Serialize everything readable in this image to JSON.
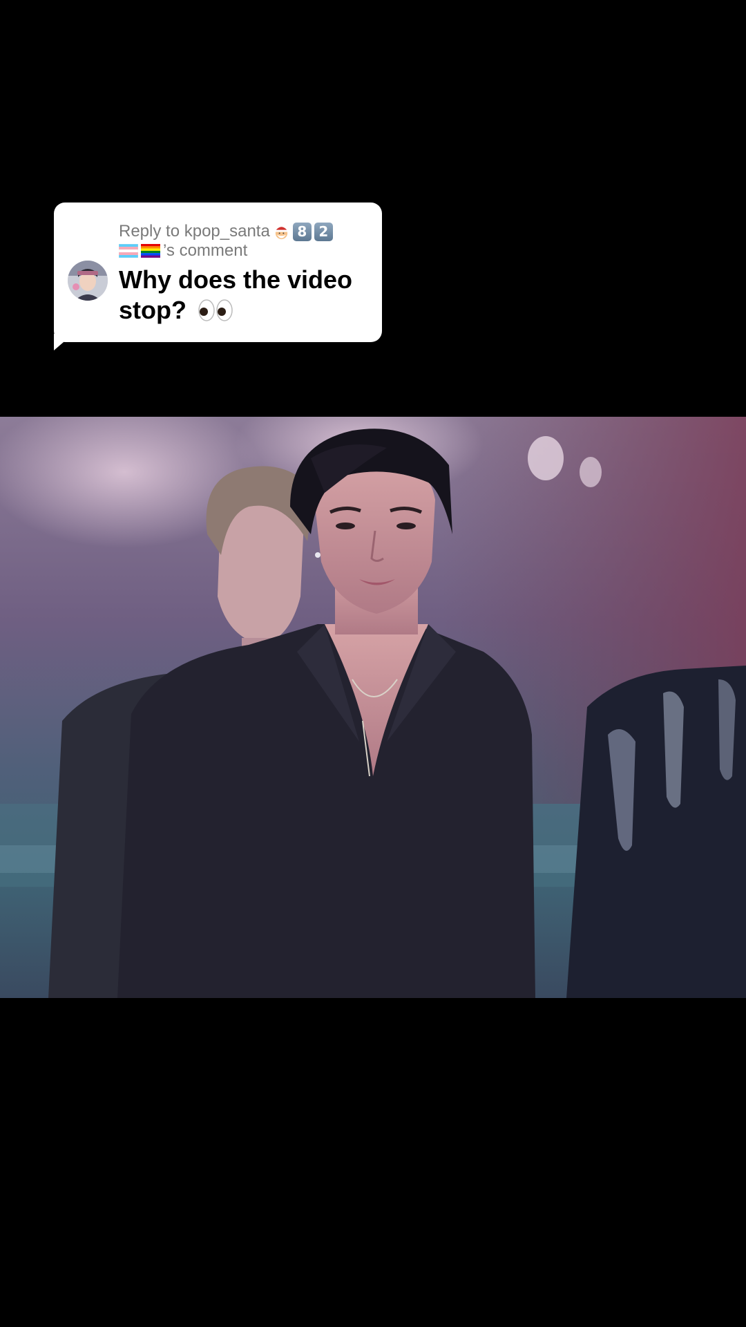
{
  "reply": {
    "prefix": "Reply to ",
    "username": "kpop_santa",
    "santa_emoji": "santa-emoji",
    "keycaps": [
      "8",
      "2"
    ],
    "flags": [
      "transgender-flag",
      "rainbow-flag"
    ],
    "suffix": "’s comment",
    "comment_text": "Why does the video stop?",
    "eyes_emoji": "eyes-emoji"
  },
  "video": {
    "scene": "performance-frame"
  },
  "colors": {
    "background": "#000000",
    "card": "#ffffff",
    "header_gray": "#7a7a7a",
    "text_black": "#000000"
  }
}
